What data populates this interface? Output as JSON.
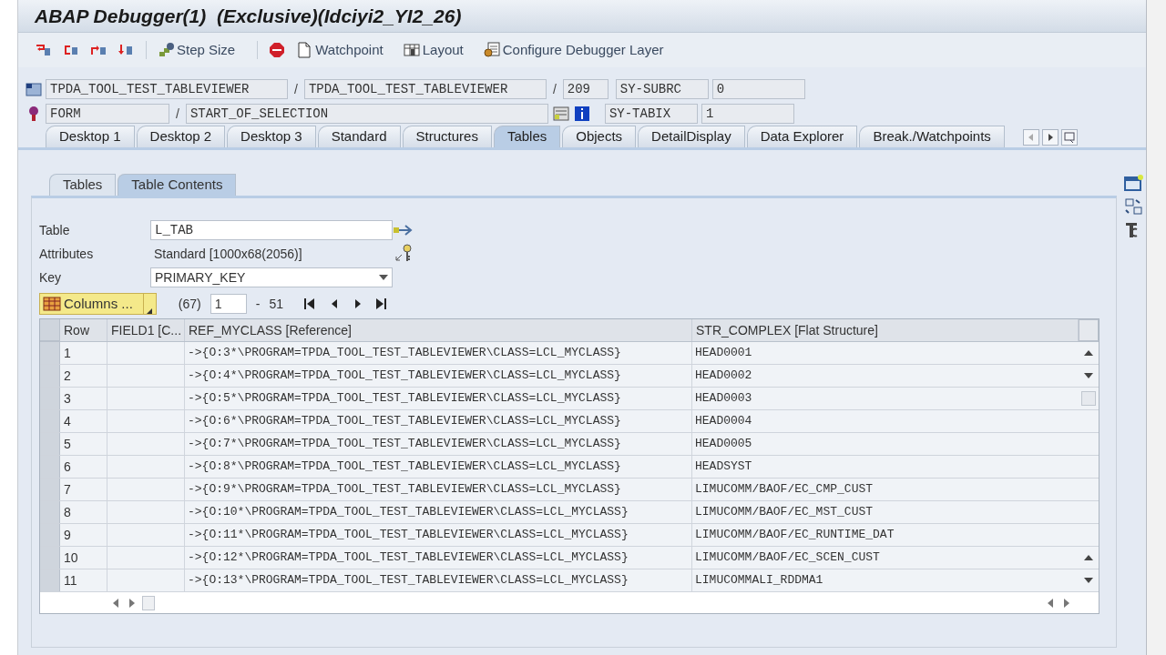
{
  "window": {
    "title": "ABAP Debugger(1)  (Exclusive)(Idciyi2_YI2_26)"
  },
  "toolbar": [
    {
      "kind": "step_into"
    },
    {
      "kind": "step_over"
    },
    {
      "kind": "return"
    },
    {
      "kind": "continue"
    },
    {
      "kind": "step_size",
      "label": "Step Size"
    },
    {
      "kind": "stop"
    },
    {
      "kind": "watchpoint",
      "label": "Watchpoint"
    },
    {
      "kind": "layout",
      "label": "Layout"
    },
    {
      "kind": "configure",
      "label": "Configure Debugger Layer"
    }
  ],
  "info_rows": [
    {
      "items": [
        {
          "kind": "field",
          "value": "TPDA_TOOL_TEST_TABLEVIEWER"
        },
        {
          "kind": "sep",
          "text": "/"
        },
        {
          "kind": "field",
          "value": "TPDA_TOOL_TEST_TABLEVIEWER"
        },
        {
          "kind": "sep",
          "text": "/"
        },
        {
          "kind": "field",
          "value": "209"
        }
      ],
      "sy_field": "SY-SUBRC",
      "sy_value": "0"
    },
    {
      "items": [
        {
          "kind": "field",
          "value": "FORM"
        },
        {
          "kind": "sep",
          "text": "/"
        },
        {
          "kind": "field",
          "value": "START_OF_SELECTION"
        }
      ],
      "sy_field": "SY-TABIX",
      "sy_value": "1"
    }
  ],
  "tabs": [
    {
      "label": "Desktop 1",
      "selected": false
    },
    {
      "label": "Desktop 2",
      "selected": false
    },
    {
      "label": "Desktop 3",
      "selected": false
    },
    {
      "label": "Standard",
      "selected": false
    },
    {
      "label": "Structures",
      "selected": false
    },
    {
      "label": "Tables",
      "selected": true
    },
    {
      "label": "Objects",
      "selected": false
    },
    {
      "label": "DetailDisplay",
      "selected": false
    },
    {
      "label": "Data Explorer",
      "selected": false
    },
    {
      "label": "Break./Watchpoints",
      "selected": false
    }
  ],
  "subtabs": [
    {
      "label": "Tables",
      "selected": false
    },
    {
      "label": "Table Contents",
      "selected": true
    }
  ],
  "form": {
    "table_label": "Table",
    "table_value": "L_TAB",
    "attributes_label": "Attributes",
    "attributes_value": "Standard [1000x68(2056)]",
    "key_label": "Key",
    "key_value": "PRIMARY_KEY"
  },
  "grid_toolbar": {
    "columns_button": "Columns ...",
    "count": "(67)",
    "from": "1",
    "dash": "-",
    "to": "51"
  },
  "table": {
    "columns": [
      "Row",
      "FIELD1 [C...",
      "REF_MYCLASS [Reference]",
      "STR_COMPLEX [Flat Structure]"
    ],
    "rows": [
      {
        "row": "1",
        "ref": "->{O:3*\\PROGRAM=TPDA_TOOL_TEST_TABLEVIEWER\\CLASS=LCL_MYCLASS}",
        "str": "HEAD0001"
      },
      {
        "row": "2",
        "ref": "->{O:4*\\PROGRAM=TPDA_TOOL_TEST_TABLEVIEWER\\CLASS=LCL_MYCLASS}",
        "str": "HEAD0002"
      },
      {
        "row": "3",
        "ref": "->{O:5*\\PROGRAM=TPDA_TOOL_TEST_TABLEVIEWER\\CLASS=LCL_MYCLASS}",
        "str": "HEAD0003"
      },
      {
        "row": "4",
        "ref": "->{O:6*\\PROGRAM=TPDA_TOOL_TEST_TABLEVIEWER\\CLASS=LCL_MYCLASS}",
        "str": "HEAD0004"
      },
      {
        "row": "5",
        "ref": "->{O:7*\\PROGRAM=TPDA_TOOL_TEST_TABLEVIEWER\\CLASS=LCL_MYCLASS}",
        "str": "HEAD0005"
      },
      {
        "row": "6",
        "ref": "->{O:8*\\PROGRAM=TPDA_TOOL_TEST_TABLEVIEWER\\CLASS=LCL_MYCLASS}",
        "str": "HEADSYST"
      },
      {
        "row": "7",
        "ref": "->{O:9*\\PROGRAM=TPDA_TOOL_TEST_TABLEVIEWER\\CLASS=LCL_MYCLASS}",
        "str": "LIMUCOMM/BAOF/EC_CMP_CUST"
      },
      {
        "row": "8",
        "ref": "->{O:10*\\PROGRAM=TPDA_TOOL_TEST_TABLEVIEWER\\CLASS=LCL_MYCLASS}",
        "str": "LIMUCOMM/BAOF/EC_MST_CUST"
      },
      {
        "row": "9",
        "ref": "->{O:11*\\PROGRAM=TPDA_TOOL_TEST_TABLEVIEWER\\CLASS=LCL_MYCLASS}",
        "str": "LIMUCOMM/BAOF/EC_RUNTIME_DAT"
      },
      {
        "row": "10",
        "ref": "->{O:12*\\PROGRAM=TPDA_TOOL_TEST_TABLEVIEWER\\CLASS=LCL_MYCLASS}",
        "str": "LIMUCOMM/BAOF/EC_SCEN_CUST"
      },
      {
        "row": "11",
        "ref": "->{O:13*\\PROGRAM=TPDA_TOOL_TEST_TABLEVIEWER\\CLASS=LCL_MYCLASS}",
        "str": "LIMUCOMMALI_RDDMA1"
      }
    ]
  }
}
